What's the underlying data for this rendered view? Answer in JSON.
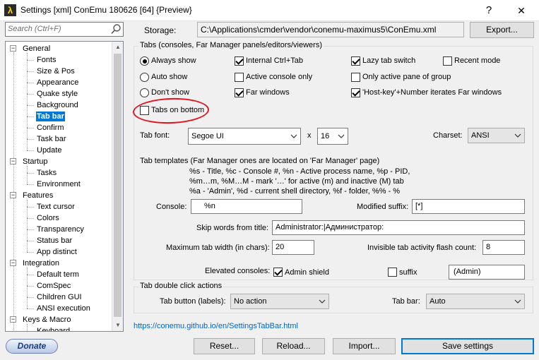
{
  "window": {
    "title": "Settings [xml] ConEmu 180626 [64] {Preview}",
    "app_icon_glyph": "λ",
    "help_label": "?",
    "close_label": "✕"
  },
  "sidebar": {
    "search_placeholder": "Search (Ctrl+F)",
    "tree": [
      {
        "label": "General",
        "level": 0,
        "expanded": true
      },
      {
        "label": "Fonts",
        "level": 1
      },
      {
        "label": "Size & Pos",
        "level": 1
      },
      {
        "label": "Appearance",
        "level": 1
      },
      {
        "label": "Quake style",
        "level": 1
      },
      {
        "label": "Background",
        "level": 1
      },
      {
        "label": "Tab bar",
        "level": 1,
        "selected": true
      },
      {
        "label": "Confirm",
        "level": 1
      },
      {
        "label": "Task bar",
        "level": 1
      },
      {
        "label": "Update",
        "level": 1
      },
      {
        "label": "Startup",
        "level": 0,
        "expanded": true
      },
      {
        "label": "Tasks",
        "level": 1
      },
      {
        "label": "Environment",
        "level": 1
      },
      {
        "label": "Features",
        "level": 0,
        "expanded": true
      },
      {
        "label": "Text cursor",
        "level": 1
      },
      {
        "label": "Colors",
        "level": 1
      },
      {
        "label": "Transparency",
        "level": 1
      },
      {
        "label": "Status bar",
        "level": 1
      },
      {
        "label": "App distinct",
        "level": 1
      },
      {
        "label": "Integration",
        "level": 0,
        "expanded": true
      },
      {
        "label": "Default term",
        "level": 1
      },
      {
        "label": "ComSpec",
        "level": 1
      },
      {
        "label": "Children GUI",
        "level": 1
      },
      {
        "label": "ANSI execution",
        "level": 1
      },
      {
        "label": "Keys & Macro",
        "level": 0,
        "expanded": true
      },
      {
        "label": "Keyboard",
        "level": 1
      }
    ],
    "donate_label": "Donate"
  },
  "storage": {
    "label": "Storage:",
    "path": "C:\\Applications\\cmder\\vendor\\conemu-maximus5\\ConEmu.xml",
    "export_label": "Export..."
  },
  "tabs_group": {
    "title": "Tabs (consoles, Far Manager panels/editors/viewers)",
    "radios": [
      {
        "label": "Always show",
        "checked": true
      },
      {
        "label": "Auto show",
        "checked": false
      },
      {
        "label": "Don't show",
        "checked": false
      }
    ],
    "col2": [
      {
        "label": "Internal Ctrl+Tab",
        "checked": true
      },
      {
        "label": "Active console only",
        "checked": false
      },
      {
        "label": "Far windows",
        "checked": true
      }
    ],
    "col3": [
      {
        "label": "Lazy tab switch",
        "checked": true
      },
      {
        "label": "Only active pane of group",
        "checked": false
      },
      {
        "label": "'Host-key'+Number iterates Far windows",
        "checked": true
      }
    ],
    "recent_mode": {
      "label": "Recent mode",
      "checked": false
    },
    "tabs_on_bottom": {
      "label": "Tabs on bottom",
      "checked": false
    },
    "tab_font_label": "Tab font:",
    "tab_font_value": "Segoe UI",
    "x_label": "x",
    "font_size_value": "16",
    "charset_label": "Charset:",
    "charset_value": "ANSI",
    "templates_title": "Tab templates (Far Manager ones are located on 'Far Manager' page)",
    "templates_line1": "%s - Title, %c - Console #, %n - Active process name, %p - PID,",
    "templates_line2": "%m…m, %M…M - mark '…' for active (m) and inactive (M) tab",
    "templates_line3": "%a - 'Admin', %d - current shell directory, %f - folder, %% - %",
    "console_label": "Console:",
    "console_value": "%n",
    "modified_suffix_label": "Modified suffix:",
    "modified_suffix_value": "[*]",
    "skip_words_label": "Skip words from title:",
    "skip_words_value": "Administrator:|Администратор:",
    "max_width_label": "Maximum tab width (in chars):",
    "max_width_value": "20",
    "flash_count_label": "Invisible tab activity flash count:",
    "flash_count_value": "8",
    "elevated_label": "Elevated consoles:",
    "admin_shield": {
      "label": "Admin shield",
      "checked": true
    },
    "suffix": {
      "label": "suffix",
      "checked": false
    },
    "admin_suffix_value": "(Admin)"
  },
  "dblclick_group": {
    "title": "Tab double click actions",
    "tab_button_label": "Tab button (labels):",
    "tab_button_value": "No action",
    "tab_bar_label": "Tab bar:",
    "tab_bar_value": "Auto"
  },
  "help_link": "https://conemu.github.io/en/SettingsTabBar.html",
  "bottom_buttons": {
    "reset": "Reset...",
    "reload": "Reload...",
    "import": "Import...",
    "save": "Save settings"
  }
}
